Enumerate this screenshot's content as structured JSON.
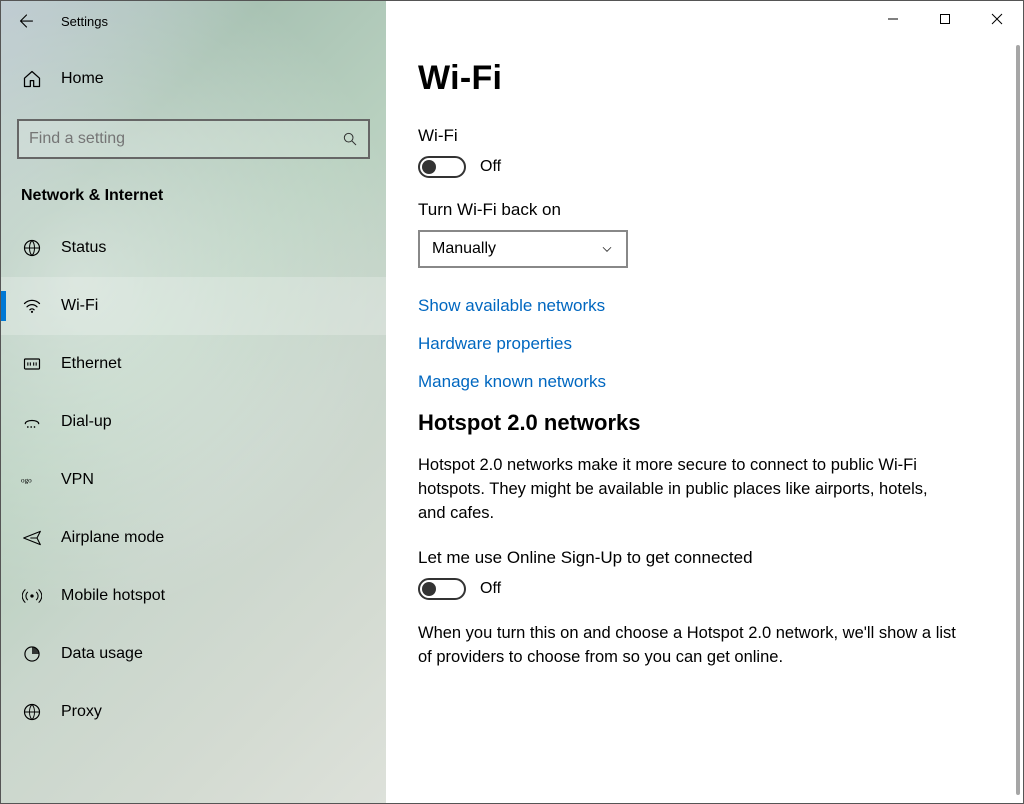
{
  "titlebar": {
    "title": "Settings"
  },
  "sidebar": {
    "home": "Home",
    "search_placeholder": "Find a setting",
    "category": "Network & Internet",
    "items": [
      {
        "label": "Status",
        "icon": "globe-icon",
        "selected": false
      },
      {
        "label": "Wi-Fi",
        "icon": "wifi-icon",
        "selected": true
      },
      {
        "label": "Ethernet",
        "icon": "ethernet-icon",
        "selected": false
      },
      {
        "label": "Dial-up",
        "icon": "dialup-icon",
        "selected": false
      },
      {
        "label": "VPN",
        "icon": "vpn-icon",
        "selected": false
      },
      {
        "label": "Airplane mode",
        "icon": "airplane-icon",
        "selected": false
      },
      {
        "label": "Mobile hotspot",
        "icon": "hotspot-icon",
        "selected": false
      },
      {
        "label": "Data usage",
        "icon": "data-usage-icon",
        "selected": false
      },
      {
        "label": "Proxy",
        "icon": "proxy-icon",
        "selected": false
      }
    ]
  },
  "main": {
    "page_title": "Wi-Fi",
    "wifi_label": "Wi-Fi",
    "wifi_toggle_state": "Off",
    "turn_back_on_label": "Turn Wi-Fi back on",
    "turn_back_on_value": "Manually",
    "links": {
      "show_networks": "Show available networks",
      "hw_props": "Hardware properties",
      "manage_known": "Manage known networks"
    },
    "hotspot_heading": "Hotspot 2.0 networks",
    "hotspot_desc": "Hotspot 2.0 networks make it more secure to connect to public Wi-Fi hotspots. They might be available in public places like airports, hotels, and cafes.",
    "signup_label": "Let me use Online Sign-Up to get connected",
    "signup_toggle_state": "Off",
    "signup_desc": "When you turn this on and choose a Hotspot 2.0 network, we'll show a list of providers to choose from so you can get online."
  }
}
